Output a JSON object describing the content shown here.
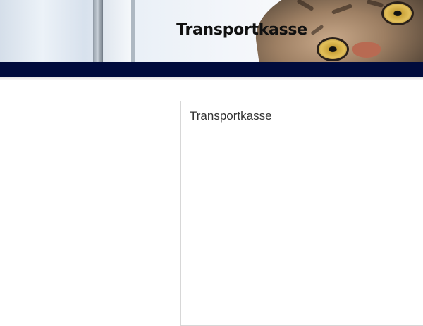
{
  "header": {
    "site_title": "Transportkasse"
  },
  "main": {
    "box_title": "Transportkasse"
  },
  "colors": {
    "nav_bar": "#000b3c",
    "title_text": "#111111",
    "box_border": "#d7d7d7"
  },
  "images": {
    "banner": "cat-photo-banner"
  }
}
